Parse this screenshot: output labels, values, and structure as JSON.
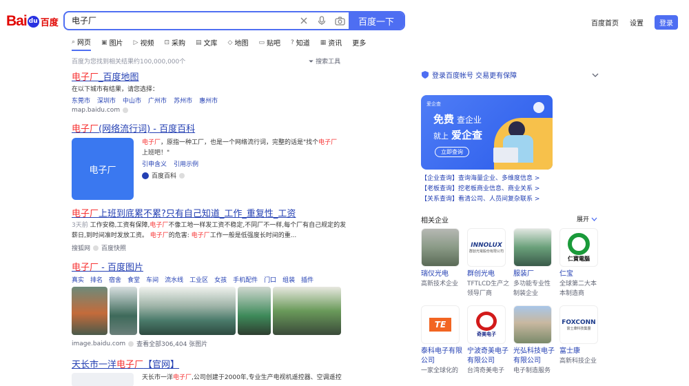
{
  "logo": {
    "bai": "Bai",
    "paw": "du",
    "cn": "百度"
  },
  "search": {
    "query": "电子厂",
    "button": "百度一下"
  },
  "topnav": {
    "home": "百度首页",
    "settings": "设置",
    "login": "登录"
  },
  "tabs": [
    "网页",
    "图片",
    "视频",
    "采购",
    "文库",
    "地图",
    "贴吧",
    "知道",
    "资讯",
    "更多"
  ],
  "meta": {
    "count": "百度为您找到相关结果约100,000,000个",
    "tool": "搜索工具"
  },
  "r1": {
    "title_em": "电子厂",
    "title_rest": "_百度地图",
    "desc": "在以下城市有结果，请您选择：",
    "cities": [
      "东莞市",
      "深圳市",
      "中山市",
      "广州市",
      "苏州市",
      "惠州市"
    ],
    "src": "map.baidu.com"
  },
  "r2": {
    "title_em": "电子厂",
    "title_rest": "(网络流行词) - 百度百科",
    "thumb": "电子厂",
    "desc_em": "电子厂",
    "desc_1": "，原指一种工厂，也是一个网络流行词，完整的话是\"找个",
    "desc_em2": "电子厂",
    "desc_2": "上班吧！\"",
    "links": [
      "引申含义",
      "引用示例"
    ],
    "src": "百度百科"
  },
  "r3": {
    "title_em": "电子厂",
    "title_rest": "上班到底累不累?只有自己知道_工作_重复性_工资",
    "date": "3天前",
    "d1": " 工作安稳,工资有保障,",
    "d_em": "电子厂",
    "d2": "不像工地一样发工资不稳定,不同厂不一样,每个厂有自己规定的发薪日,到时间准时发放工资。",
    "d_em2": "电子厂",
    "d3": "的危害: ",
    "d_em3": "电子厂",
    "d4": "工作一般是低强度长时间的重...",
    "src": "搜狐网",
    "src2": "百度快照"
  },
  "r4": {
    "title_em": "电子厂",
    "title_rest": " - 百度图片",
    "tags": [
      "真实",
      "排名",
      "宿舍",
      "食堂",
      "车间",
      "流水线",
      "工业区",
      "女孩",
      "手机配件",
      "门口",
      "组装",
      "插件"
    ],
    "src": "image.baidu.com",
    "src2": "查看全部306,404 张图片"
  },
  "r5": {
    "title_a": "天长市一洋",
    "title_em": "电子厂",
    "title_b": "【官网】",
    "desc_a": "天长市一洋",
    "desc_em": "电子厂",
    "desc_b": ",公司创建于2000年,专业生产电视机遥控器、空调遥控"
  },
  "right": {
    "account": "登录百度帐号 交易更有保障",
    "ad": {
      "free": "免费",
      "small1": "查企业",
      "line2a": "就上",
      "line2b": "爱企查",
      "btn": "立即查询",
      "brand": "爱企查"
    },
    "ad_links": [
      "【企业查询】查询海量企业、多维度信息 >",
      "【老板查询】挖老板商业信息、商业关系 >",
      "【关系查询】看清公司、人员间复杂联系 >"
    ],
    "related_title": "相关企业",
    "expand": "展开",
    "companies": [
      {
        "name": "瑞仪光电",
        "desc": "高新技术企业"
      },
      {
        "name": "群创光电",
        "desc": "TFTLCD生产之领导厂商"
      },
      {
        "name": "服装厂",
        "desc": "多功能专业性制装企业"
      },
      {
        "name": "仁宝",
        "desc": "全球第二大本本制造商"
      },
      {
        "name": "泰科电子有限公司",
        "desc": "一家全球化的"
      },
      {
        "name": "宁波奇美电子有限公司",
        "desc": "台湾奇美电子"
      },
      {
        "name": "光弘科技电子有限公司",
        "desc": "电子制造服务"
      },
      {
        "name": "富士康",
        "desc": "高新科技企业"
      }
    ],
    "logos": {
      "innolux": "INNOLUX",
      "innolux_sub": "群創光電股份有限公司",
      "compal": "仁寶電腦",
      "te": "TE",
      "chimei": "奇美电子",
      "foxconn": "FOXCONN",
      "foxconn_sub": "富士康科技集團"
    }
  },
  "colors": {
    "accent": "#4e6ef2",
    "link": "#2440b3",
    "em": "#f73131"
  }
}
